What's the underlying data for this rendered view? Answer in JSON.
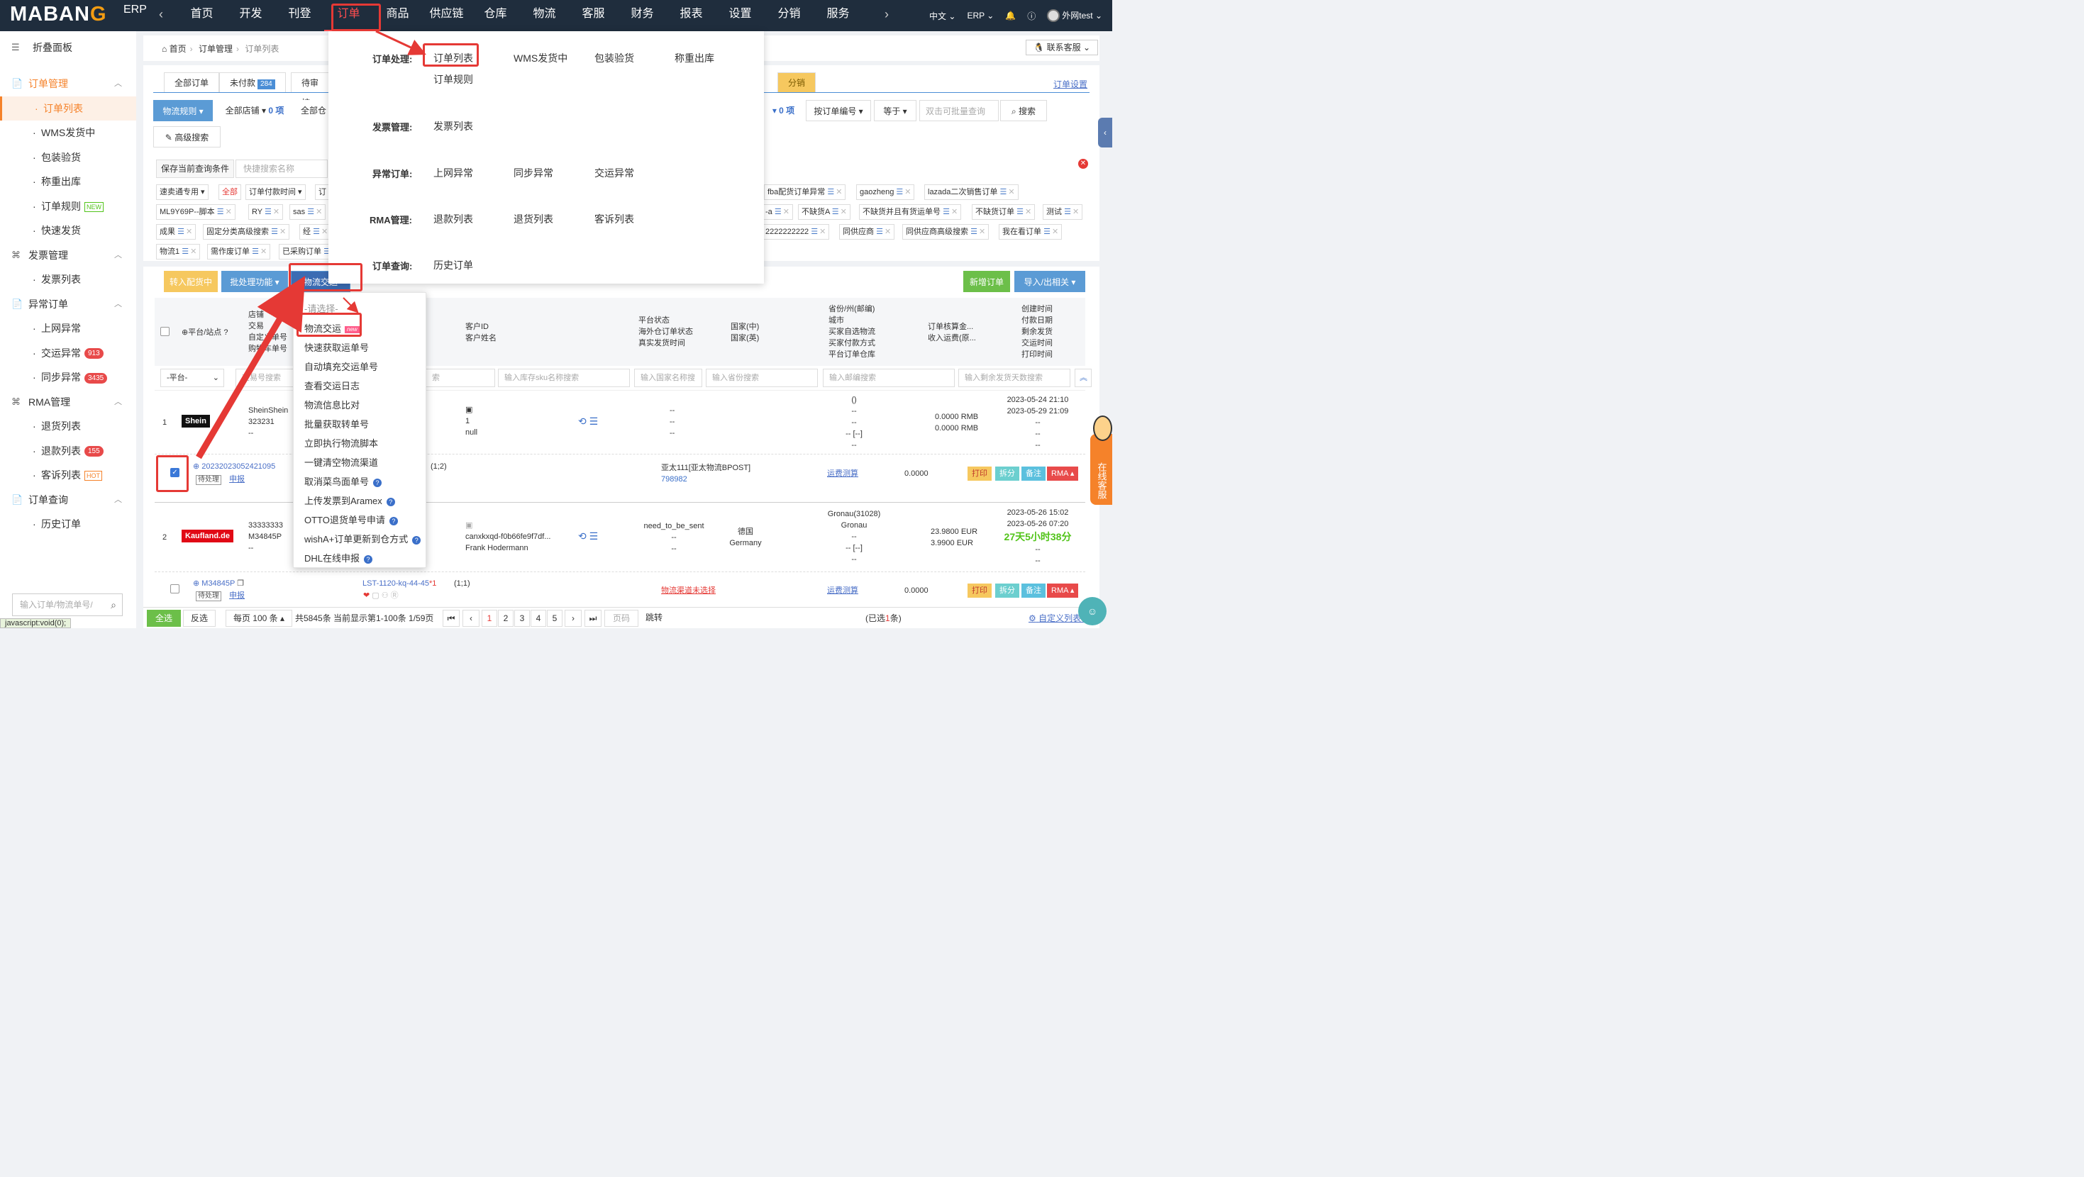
{
  "header": {
    "logo_main": "MABAN",
    "logo_g": "G",
    "logo_erp": "ERP",
    "nav_back": "‹",
    "nav_forward": "›",
    "nav": [
      "首页",
      "开发",
      "刊登",
      "订单",
      "商品",
      "供应链",
      "仓库",
      "物流",
      "客服",
      "财务",
      "报表",
      "设置",
      "分销",
      "服务"
    ],
    "active_nav": "订单",
    "lang": "中文",
    "erp_menu": "ERP",
    "user": "外网test"
  },
  "sidebar": {
    "collapse": "折叠面板",
    "groups": [
      {
        "label": "订单管理",
        "items": [
          {
            "label": "订单列表",
            "active": true
          },
          {
            "label": "WMS发货中"
          },
          {
            "label": "包装验货"
          },
          {
            "label": "称重出库"
          },
          {
            "label": "订单规则",
            "tag": "NEW"
          },
          {
            "label": "快速发货"
          }
        ]
      },
      {
        "label": "发票管理",
        "items": [
          {
            "label": "发票列表"
          }
        ]
      },
      {
        "label": "异常订单",
        "items": [
          {
            "label": "上网异常"
          },
          {
            "label": "交运异常",
            "badge": "913"
          },
          {
            "label": "同步异常",
            "badge": "3435"
          }
        ]
      },
      {
        "label": "RMA管理",
        "items": [
          {
            "label": "退货列表"
          },
          {
            "label": "退款列表",
            "badge": "155"
          },
          {
            "label": "客诉列表",
            "tag": "HOT"
          }
        ]
      },
      {
        "label": "订单查询",
        "items": [
          {
            "label": "历史订单"
          }
        ]
      }
    ],
    "search_placeholder": "输入订单/物流单号/",
    "status_url": "javascript:void(0);"
  },
  "breadcrumb": {
    "home": "首页",
    "section": "订单管理",
    "current": "订单列表"
  },
  "support_label": "联系客服",
  "tabs": {
    "all": "全部订单",
    "unpaid": "未付款",
    "unpaid_count": "284",
    "pending": "待审核",
    "distribution": "分销",
    "order_settings": "订单设置"
  },
  "filters": {
    "logistics_rule": "物流规则",
    "all_stores": "全部店铺",
    "zero_items": "0 项",
    "all_warehouses": "全部仓",
    "zero_items2": "0 项",
    "by_order_no": "按订单编号",
    "equals": "等于",
    "batch_query": "双击可批量查询",
    "search": "搜索",
    "advanced": "高级搜索",
    "save_condition": "保存当前查询条件",
    "quick_name": "快捷搜索名称"
  },
  "chips": {
    "row1": [
      "速卖通专用",
      "全部",
      "订单付款时间",
      "订",
      "fba配货订单异常",
      "gaozheng",
      "lazada二次销售订单"
    ],
    "row2": [
      "ML9Y69P--脚本",
      "RY",
      "sas",
      "-a",
      "不缺货A",
      "不缺货并且有货运单号",
      "不缺货订单",
      "测试"
    ],
    "row3": [
      "成果",
      "固定分类高级搜索",
      "经",
      "2222222222",
      "同供应商",
      "同供应商高级搜索",
      "我在看订单"
    ],
    "row4": [
      "物流1",
      "需作废订单",
      "已采购订单"
    ]
  },
  "actions": {
    "to_picking": "转入配货中",
    "batch": "批处理功能",
    "logistics_ship": "物流交运",
    "new_order": "新增订单",
    "import_export": "导入/出相关"
  },
  "table": {
    "headers": {
      "platform": "平台/站点",
      "store_col": [
        "店铺",
        "交易",
        "自定义单号",
        "购物车单号"
      ],
      "customer": [
        "客户ID",
        "客户姓名"
      ],
      "platform_status": [
        "平台状态",
        "海外仓订单状态",
        "真实发货时间"
      ],
      "country": [
        "国家(中)",
        "国家(英)"
      ],
      "province": [
        "省份/州(邮编)",
        "城市",
        "买家自选物流",
        "买家付款方式",
        "平台订单仓库"
      ],
      "accounting": [
        "订单核算金...",
        "收入运费(原..."
      ],
      "times": [
        "创建时间",
        "付款日期",
        "剩余发货",
        "交运时间",
        "打印时间"
      ]
    },
    "filter_placeholders": {
      "platform": "-平台-",
      "trade": "交易号搜索",
      "sku": "输入库存sku名称搜索",
      "country": "输入国家名称搜",
      "province": "输入省份搜索",
      "zip": "输入邮编搜索",
      "remaining": "输入剩余发货天数搜索",
      "col_suffix": "索"
    },
    "rows": [
      {
        "no": "1",
        "platform": "Shein",
        "platform_color": "#111111",
        "store": "SheinShein",
        "trade": "323231",
        "dash": "--",
        "customer_id": "1",
        "customer_name": "null",
        "status": [
          "--",
          "--",
          "--"
        ],
        "province": [
          "()",
          "--",
          "--",
          "-- [--]",
          "--"
        ],
        "amount1": "0.0000 RMB",
        "amount2": "0.0000 RMB",
        "created": "2023-05-24 21:10",
        "paid": "2023-05-29 21:09",
        "tail": [
          "--",
          "--",
          "--"
        ],
        "order_no": "20232023052421095",
        "state": "待处理",
        "declare": "申报",
        "qty": "(1;2)",
        "logistics": "亚太111[亚太物流BPOST]",
        "tracking": "798982",
        "freight_calc": "运费测算",
        "freight": "0.0000"
      },
      {
        "no": "2",
        "platform": "Kaufland.de",
        "platform_color": "#e10915",
        "store": "33333333",
        "trade": "M34845P",
        "dash": "--",
        "customer_id": "canxkxqd-f0b66fe9f7df...",
        "customer_name": "Frank Hodermann",
        "status": [
          "need_to_be_sent",
          "--",
          "--"
        ],
        "country_cn": "德国",
        "country_en": "Germany",
        "province": [
          "Gronau(31028)",
          "Gronau",
          "--",
          "-- [--]",
          "--"
        ],
        "amount1": "23.9800 EUR",
        "amount2": "3.9900 EUR",
        "created": "2023-05-26 15:02",
        "paid": "2023-05-26 07:20",
        "remaining": "27天5小时38分",
        "tail": [
          "--",
          "--"
        ],
        "order_no": "M34845P",
        "state": "待处理",
        "declare": "申报",
        "sku_line": "LST-1120-kq-44-45",
        "sku_qty": "*1",
        "qty": "(1;1)",
        "logistics": "物流渠道未选择",
        "freight_calc": "运费测算",
        "freight": "0.0000"
      }
    ],
    "row_actions": [
      "打印",
      "拆分",
      "备注",
      "RMA"
    ]
  },
  "pager": {
    "select_all": "全选",
    "invert": "反选",
    "per_page": "每页 100 条",
    "summary": "共5845条 当前显示第1-100条 1/59页",
    "pages": [
      "1",
      "2",
      "3",
      "4",
      "5"
    ],
    "page_placeholder": "页码",
    "jump": "跳转",
    "selected_prefix": "(已选",
    "selected_count": "1",
    "selected_suffix": "条)",
    "custom_fields": "自定义列表字段"
  },
  "mega_menu": {
    "sections": [
      {
        "title": "订单处理:",
        "items": [
          "订单列表",
          "WMS发货中",
          "包装验货",
          "称重出库",
          "订单规则"
        ]
      },
      {
        "title": "发票管理:",
        "items": [
          "发票列表"
        ]
      },
      {
        "title": "异常订单:",
        "items": [
          "上网异常",
          "同步异常",
          "交运异常"
        ]
      },
      {
        "title": "RMA管理:",
        "items": [
          "退款列表",
          "退货列表",
          "客诉列表"
        ]
      },
      {
        "title": "订单查询:",
        "items": [
          "历史订单"
        ]
      }
    ]
  },
  "dropdown": {
    "placeholder": "-请选择-",
    "items": [
      "物流交运",
      "快速获取运单号",
      "自动填充交运单号",
      "查看交运日志",
      "物流信息比对",
      "批量获取转单号",
      "立即执行物流脚本",
      "一键清空物流渠道",
      "取消菜鸟面单号",
      "上传发票到Aramex",
      "OTTO退货单号申请",
      "wishA+订单更新到仓方式",
      "DHL在线申报"
    ],
    "new_tag": "new"
  },
  "float": {
    "online_service": "在线客服"
  }
}
